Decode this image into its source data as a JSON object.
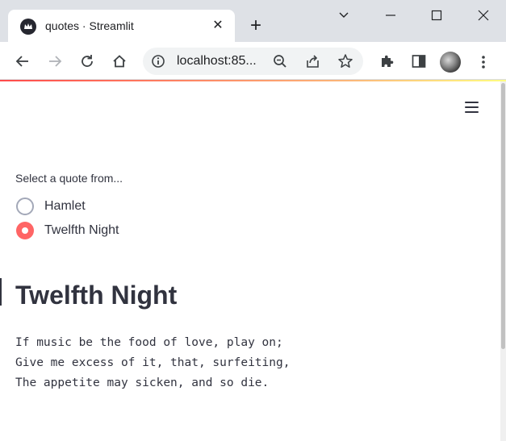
{
  "browser": {
    "tab_title": "quotes · Streamlit",
    "url": "localhost:85...",
    "new_tab_label": "+",
    "close_tab_label": "✕"
  },
  "app": {
    "radio": {
      "label": "Select a quote from...",
      "options": [
        "Hamlet",
        "Twelfth Night"
      ],
      "selected": "Twelfth Night"
    },
    "title": "Twelfth Night",
    "quote_lines": [
      "If music be the food of love, play on;",
      "Give me excess of it, that, surfeiting,",
      "The appetite may sicken, and so die."
    ]
  },
  "colors": {
    "primary": "#ff4b4b",
    "text": "#31333f",
    "tabstrip": "#dee1e6"
  }
}
